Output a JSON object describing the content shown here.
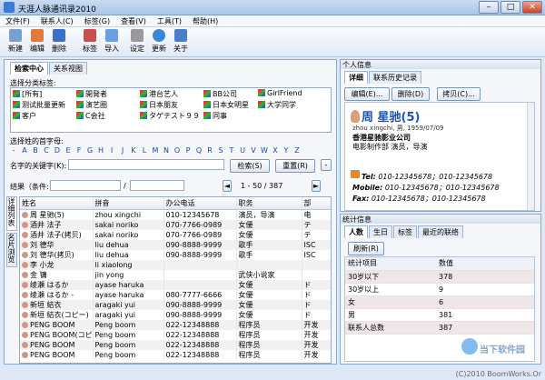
{
  "window": {
    "title": "天涯人脉通讯录2010",
    "controls": [
      "–",
      "□",
      "✕"
    ]
  },
  "menu": [
    "文件(F)",
    "联系人(C)",
    "标签(G)",
    "查看(V)",
    "工具(T)",
    "帮助(H)"
  ],
  "toolbar": [
    {
      "label": "新建",
      "icon": "new-contact-icon",
      "color": "#7aa0d0"
    },
    {
      "label": "编辑",
      "icon": "edit-icon",
      "color": "#e07a3a"
    },
    {
      "label": "删除",
      "icon": "delete-icon",
      "color": "#3a6fc8"
    },
    {
      "label": "标签",
      "icon": "tag-icon",
      "color": "#c94f4f"
    },
    {
      "label": "导入",
      "icon": "import-icon",
      "color": "#6aa0e0"
    },
    {
      "label": "设定",
      "icon": "settings-icon",
      "color": "#9a9a9a"
    },
    {
      "label": "更新",
      "icon": "update-icon",
      "color": "#3a86d8"
    },
    {
      "label": "关于",
      "icon": "about-icon",
      "color": "#4a7fc8"
    }
  ],
  "left": {
    "tabs": [
      "检索中心",
      "关系视图"
    ],
    "category_label": "选择分类标签:",
    "categories": [
      "[所有]",
      "開発者",
      "港台艺人",
      "BB公司",
      "GirlFriend",
      "测试批量更新",
      "演艺圈",
      "日本朋友",
      "日本女明星",
      "大学同学",
      "客户",
      "C会社",
      "タゲテスト９９",
      "同事"
    ],
    "letters_label": "选择姓的首字母:",
    "letters": [
      "-",
      "A",
      "B",
      "C",
      "D",
      "E",
      "F",
      "G",
      "H",
      "I",
      "J",
      "K",
      "L",
      "M",
      "N",
      "O",
      "P",
      "Q",
      "R",
      "S",
      "T",
      "U",
      "V",
      "W",
      "X",
      "Y",
      "Z"
    ],
    "keyword_label": "名字的关键字(K):",
    "keyword_value": "",
    "search_btn": "检索(S)",
    "reset_btn": "重置(R)",
    "minus_btn": "-",
    "result_label": "结果（条件:",
    "result_sep": "/",
    "page_info": "1 - 50 / 387",
    "side_tabs": [
      "详细列表",
      "名片浏览"
    ],
    "columns": [
      "姓名",
      "拼音",
      "办公电话",
      "职务",
      "部"
    ],
    "rows": [
      [
        "周 星驰(5)",
        "zhou xingchi",
        "010-12345678",
        "演员，导演",
        "电"
      ],
      [
        "酒井 法子",
        "sakai noriko",
        "070-7766-0989",
        "女優",
        "テ"
      ],
      [
        "酒井 法子(拷贝)",
        "sakai noriko",
        "070-7766-0989",
        "女優",
        "テ"
      ],
      [
        "刘 德华",
        "liu dehua",
        "090-8888-9999",
        "歌手",
        "ISC"
      ],
      [
        "刘 德华(拷贝)",
        "liu dehua",
        "090-8888-9999",
        "歌手",
        "ISC"
      ],
      [
        "李 小龙",
        "li xiaolong",
        "",
        "",
        ""
      ],
      [
        "金 镛",
        "jin yong",
        "",
        "武侠小说家",
        ""
      ],
      [
        "绫瀬 はるか",
        "ayase haruka",
        "",
        "女優",
        "ド"
      ],
      [
        "绫瀬 はるか -",
        "ayase haruka",
        "080-7777-6666",
        "女優",
        "ド"
      ],
      [
        "新垣 結衣",
        "aragaki yui",
        "090-8888-9999",
        "女優",
        "ド"
      ],
      [
        "新垣 結衣(コピー)",
        "aragaki yui",
        "090-8888-9999",
        "女優",
        "ド"
      ],
      [
        "PENG BOOM",
        "Peng boom",
        "022-12348888",
        "程序员",
        "开发"
      ],
      [
        "PENG BOOM(コピー)",
        "Peng boom",
        "022-12348888",
        "程序员",
        "开发"
      ],
      [
        "PENG BOOM",
        "Peng boom",
        "022-12348888",
        "程序员",
        "开发"
      ],
      [
        "PENG BOOM",
        "Peng boom",
        "022-12348888",
        "程序员",
        "开发"
      ]
    ]
  },
  "right": {
    "panel_title": "个人信息",
    "tabs": [
      "详细",
      "联系历史记录"
    ],
    "buttons": [
      "编辑(E)...",
      "删除(D)",
      "拷贝(C)..."
    ],
    "name": "周 星驰(5)",
    "pinyin_line": "zhou xingchi, 男, 1959/07/09",
    "company": "香港星驰影业公司",
    "dept": "电影制作部 演员，导演",
    "tel_label": "Tel:",
    "tel": "010-12345678；010-12345678",
    "mobile_label": "Mobile:",
    "mobile": "010-12345678；010-12345678",
    "fax_label": "Fax:",
    "fax": "010-12345678；010-12345678",
    "stats_title": "统计信息",
    "stats_tabs": [
      "人数",
      "生日",
      "标签",
      "最近的联络"
    ],
    "refresh_btn": "刷新(R)",
    "stats_cols": [
      "统计项目",
      "数值"
    ],
    "stats": [
      [
        "30岁以下",
        "378"
      ],
      [
        "30岁以上",
        "9"
      ],
      [
        "女",
        "6"
      ],
      [
        "男",
        "381"
      ],
      [
        "联系人总数",
        "387"
      ]
    ]
  },
  "watermark": "(C)2010 BoomWorks.Or",
  "logo": "当下软件园"
}
